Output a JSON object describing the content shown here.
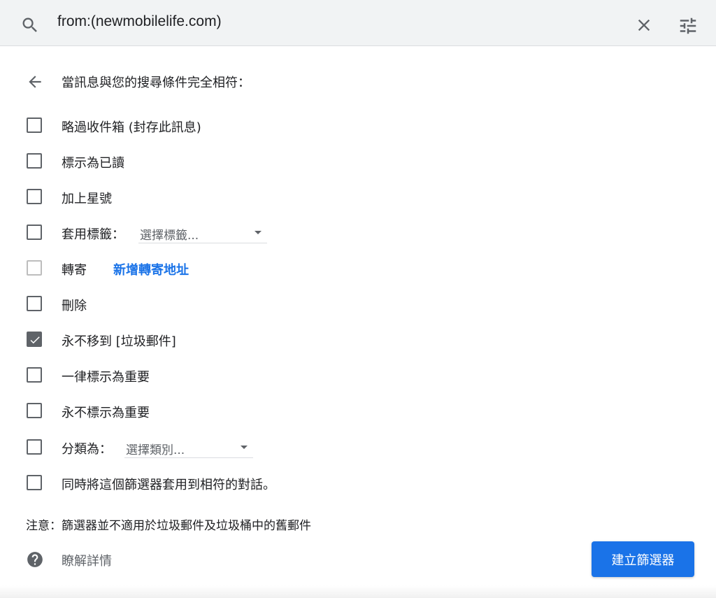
{
  "search": {
    "query": "from:(newmobilelife.com)"
  },
  "icons": {
    "search": "search-icon",
    "clear": "close-icon",
    "options": "tune-icon",
    "back": "arrow-left-icon",
    "help": "help-circle-icon"
  },
  "filter": {
    "heading": "當訊息與您的搜尋條件完全相符：",
    "options": [
      {
        "label": "略過收件箱 (封存此訊息)",
        "checked": false
      },
      {
        "label": "標示為已讀",
        "checked": false
      },
      {
        "label": "加上星號",
        "checked": false
      },
      {
        "label": "套用標籤：",
        "checked": false,
        "select": "選擇標籤..."
      },
      {
        "label": "轉寄",
        "checked": false,
        "disabled": true,
        "link": "新增轉寄地址"
      },
      {
        "label": "刪除",
        "checked": false
      },
      {
        "label": "永不移到 [垃圾郵件]",
        "checked": true
      },
      {
        "label": "一律標示為重要",
        "checked": false
      },
      {
        "label": "永不標示為重要",
        "checked": false
      },
      {
        "label": "分類為：",
        "checked": false,
        "select": "選擇類別..."
      },
      {
        "label": "同時將這個篩選器套用到相符的對話。",
        "checked": false
      }
    ],
    "note": "注意：篩選器並不適用於垃圾郵件及垃圾桶中的舊郵件",
    "learn_more": "瞭解詳情",
    "create_button": "建立篩選器"
  },
  "colors": {
    "accent": "#1a73e8",
    "search_bg": "#f1f3f4",
    "checkbox": "#5f6368"
  }
}
